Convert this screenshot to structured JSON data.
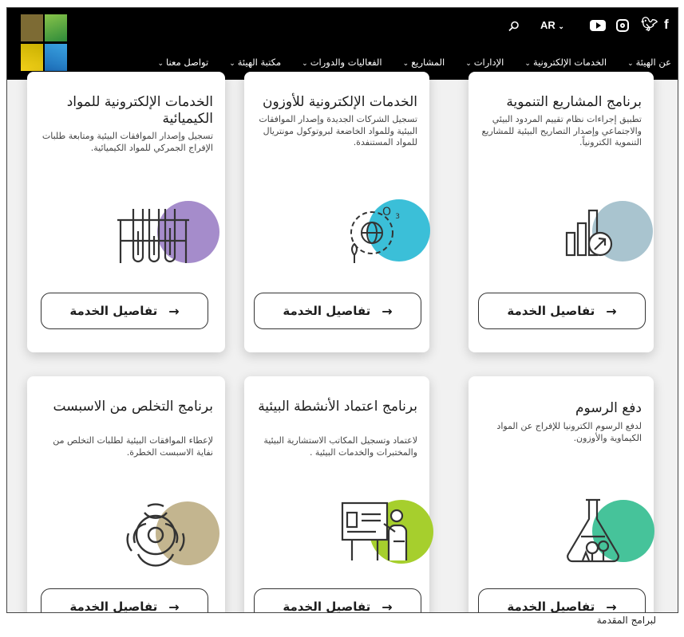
{
  "utility": {
    "language": "AR",
    "icons": [
      "search-icon",
      "youtube-icon",
      "instagram-icon",
      "twitter-icon",
      "facebook-icon"
    ]
  },
  "nav": {
    "items": [
      "عن الهيئة",
      "الخدمات الإلكترونية",
      "الإدارات",
      "المشاريع",
      "الفعاليات والدورات",
      "مكتبة الهيئة",
      "تواصل معنا"
    ]
  },
  "cards": [
    {
      "title": "برنامج المشاريع التنموية",
      "description": "تطبيق إجراءات نظام تقييم المردود البيئي والاجتماعي وإصدار التصاريح البيئية للمشاريع التنموية الكترونياً.",
      "button": "تفاصيل الخدمة",
      "icon": "chart-growth-icon",
      "accent": "#a9c4cf"
    },
    {
      "title": "الخدمات الإلكترونية للأوزون",
      "description": "تسجيل الشركات الجديدة وإصدار الموافقات البيئية وللمواد الخاضعة لبروتوكول مونتريال للمواد المستنفدة.",
      "button": "تفاصيل الخدمة",
      "icon": "globe-ozone-icon",
      "accent": "#3bbfd8"
    },
    {
      "title": "الخدمات الإلكترونية للمواد الكيميائية",
      "description": "تسجيل وإصدار الموافقات البيئية ومتابعة طلبات الإفراج الجمركي للمواد الكيميائية.",
      "button": "تفاصيل الخدمة",
      "icon": "test-tubes-icon",
      "accent": "#a58ccb"
    },
    {
      "title": "دفع الرسوم",
      "description": "لدفع الرسوم الكترونيا للإفراج عن المواد الكيماوية والأوزون.",
      "button": "تفاصيل الخدمة",
      "icon": "flask-plants-icon",
      "accent": "#46c39a"
    },
    {
      "title": "برنامج اعتماد الأنشطة البيئية",
      "description": "لاعتماد وتسجيل المكاتب الاستشارية البيئية والمختبرات والخدمات البيئية .",
      "button": "تفاصيل الخدمة",
      "icon": "presentation-icon",
      "accent": "#a6cf2d"
    },
    {
      "title": "برنامج التخلص من الاسبست",
      "description": "لإعطاء الموافقات البيئية لطلبات التخلص من نفاية الاسبست الخطرة.",
      "button": "تفاصيل الخدمة",
      "icon": "biohazard-icon",
      "accent": "#c3b58f"
    }
  ],
  "caption": "لبرامج المقدمة"
}
